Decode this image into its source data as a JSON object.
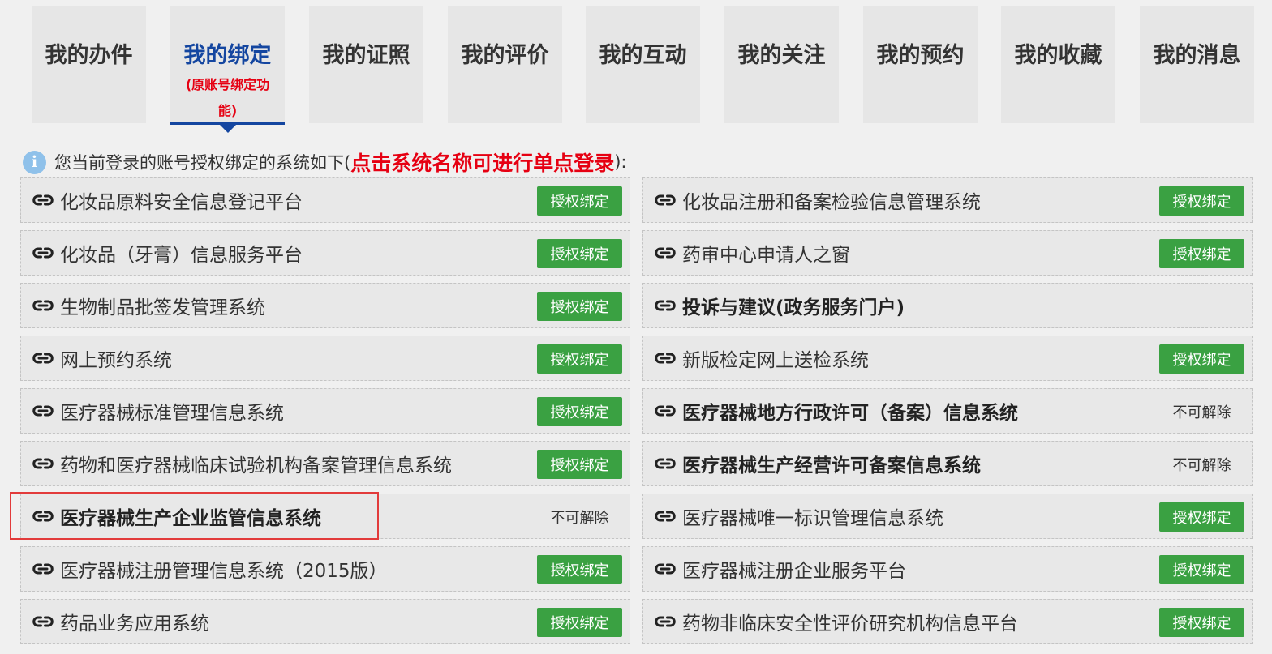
{
  "tabs": [
    {
      "label": "我的办件"
    },
    {
      "label": "我的绑定",
      "sub": "(原账号绑定功能)"
    },
    {
      "label": "我的证照"
    },
    {
      "label": "我的评价"
    },
    {
      "label": "我的互动"
    },
    {
      "label": "我的关注"
    },
    {
      "label": "我的预约"
    },
    {
      "label": "我的收藏"
    },
    {
      "label": "我的消息"
    }
  ],
  "notice": {
    "prefix": "您当前登录的账号授权绑定的系统如下(",
    "highlight": "点击系统名称可进行单点登录",
    "suffix": "):"
  },
  "left_systems": [
    {
      "name": "化妆品原料安全信息登记平台",
      "action": "授权绑定",
      "bold": false
    },
    {
      "name": "化妆品（牙膏）信息服务平台",
      "action": "授权绑定",
      "bold": false
    },
    {
      "name": "生物制品批签发管理系统",
      "action": "授权绑定",
      "bold": false
    },
    {
      "name": "网上预约系统",
      "action": "授权绑定",
      "bold": false
    },
    {
      "name": "医疗器械标准管理信息系统",
      "action": "授权绑定",
      "bold": false
    },
    {
      "name": "药物和医疗器械临床试验机构备案管理信息系统",
      "action": "授权绑定",
      "bold": false
    },
    {
      "name": "医疗器械生产企业监管信息系统",
      "status": "不可解除",
      "bold": true
    },
    {
      "name": "医疗器械注册管理信息系统（2015版）",
      "action": "授权绑定",
      "bold": false
    },
    {
      "name": "药品业务应用系统",
      "action": "授权绑定",
      "bold": false
    }
  ],
  "right_systems": [
    {
      "name": "化妆品注册和备案检验信息管理系统",
      "action": "授权绑定",
      "bold": false
    },
    {
      "name": "药审中心申请人之窗",
      "action": "授权绑定",
      "bold": false
    },
    {
      "name": "投诉与建议(政务服务门户)",
      "bold": true
    },
    {
      "name": "新版检定网上送检系统",
      "action": "授权绑定",
      "bold": false
    },
    {
      "name": "医疗器械地方行政许可（备案）信息系统",
      "status": "不可解除",
      "bold": true
    },
    {
      "name": "医疗器械生产经营许可备案信息系统",
      "status": "不可解除",
      "bold": true
    },
    {
      "name": "医疗器械唯一标识管理信息系统",
      "action": "授权绑定",
      "bold": false
    },
    {
      "name": "医疗器械注册企业服务平台",
      "action": "授权绑定",
      "bold": false
    },
    {
      "name": "药物非临床安全性评价研究机构信息平台",
      "action": "授权绑定",
      "bold": false
    }
  ],
  "colors": {
    "accent": "#1446a0",
    "button": "#3aa142",
    "alert": "#e60012"
  },
  "icons": {
    "row": "link-icon",
    "notice": "info-icon"
  }
}
